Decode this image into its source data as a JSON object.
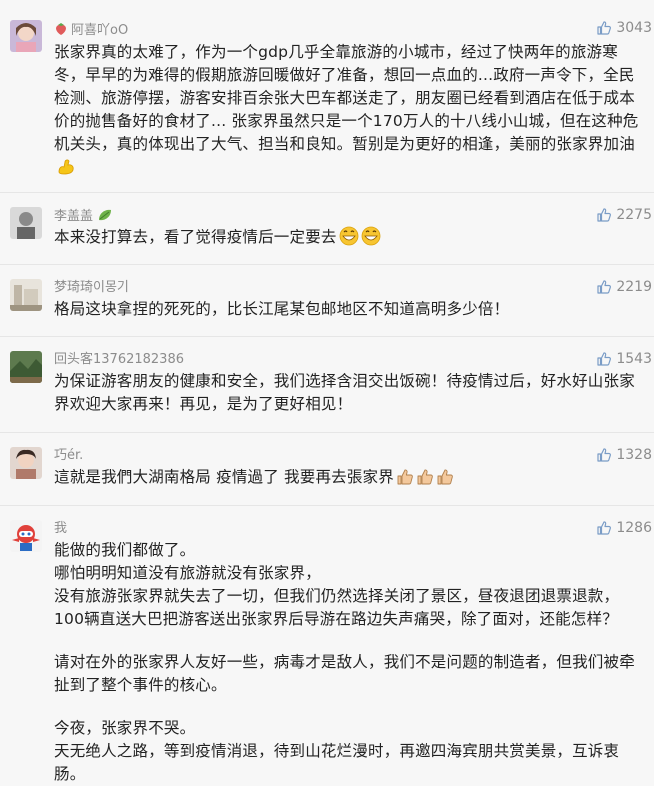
{
  "comments": [
    {
      "username": "阿喜吖oO",
      "likes": "3043",
      "text": "张家界真的太难了，作为一个gdp几乎全靠旅游的小城市，经过了快两年的旅游寒冬，早早的为难得的假期旅游回暖做好了准备，想回一点血的...政府一声令下，全民检测、旅游停摆，游客安排百余张大巴车都送走了，朋友圈已经看到酒店在低于成本价的抛售备好的食材了... 张家界虽然只是一个170万人的十八线小山城，但在这种危机关头，真的体现出了大气、担当和良知。暂别是为更好的相逢，美丽的张家界加油"
    },
    {
      "username": "李盖盖",
      "likes": "2275",
      "text": "本来没打算去，看了觉得疫情后一定要去"
    },
    {
      "username": "梦琦琦이몽기",
      "likes": "2219",
      "text": "格局这块拿捏的死死的，比长江尾某包邮地区不知道高明多少倍！"
    },
    {
      "username": "回头客13762182386",
      "likes": "1543",
      "text": "为保证游客朋友的健康和安全，我们选择含泪交出饭碗！待疫情过后，好水好山张家界欢迎大家再来！再见，是为了更好相见！"
    },
    {
      "username": "巧ér.",
      "likes": "1328",
      "text": "這就是我們大湖南格局 疫情過了 我要再去張家界"
    },
    {
      "username": "我",
      "likes": "1286",
      "paragraphs": [
        "能做的我们都做了。",
        "哪怕明明知道没有旅游就没有张家界，",
        "没有旅游张家界就失去了一切，但我们仍然选择关闭了景区，昼夜退团退票退款，",
        "100辆直送大巴把游客送出张家界后导游在路边失声痛哭，除了面对，还能怎样？",
        "",
        "请对在外的张家界人友好一些，病毒才是敌人，我们不是问题的制造者，但我们被牵扯到了整个事件的核心。",
        "",
        "今夜，张家界不哭。",
        "天无绝人之路，等到疫情消退，待到山花烂漫时，再邀四海宾朋共赏美景，互诉衷肠。"
      ]
    }
  ]
}
